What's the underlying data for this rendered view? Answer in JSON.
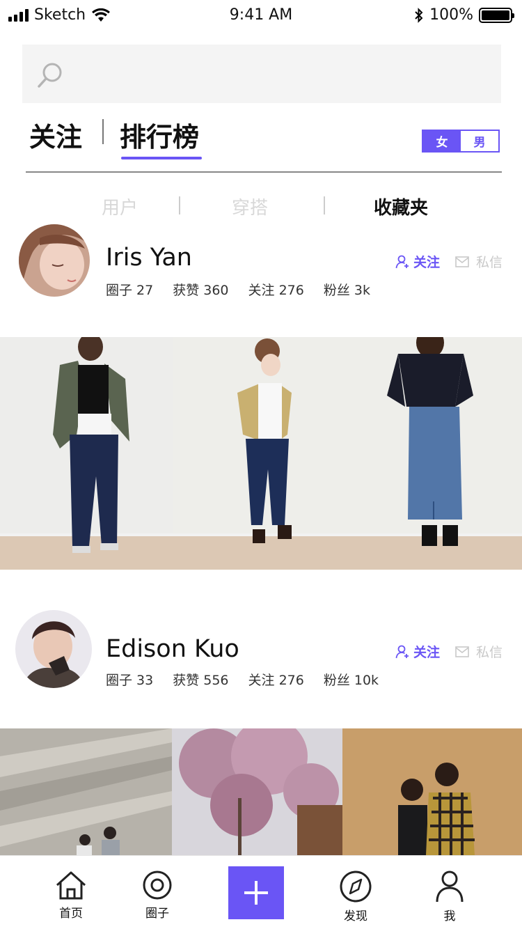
{
  "status_bar": {
    "carrier": "Sketch",
    "time": "9:41 AM",
    "battery": "100%"
  },
  "search": {
    "placeholder": ""
  },
  "top_tabs": {
    "following": "关注",
    "ranking": "排行榜",
    "active": "排行榜"
  },
  "gender_toggle": {
    "female": "女",
    "male": "男",
    "active": "女"
  },
  "sub_tabs": {
    "users": "用户",
    "outfits": "穿搭",
    "favorites": "收藏夹",
    "active": "收藏夹"
  },
  "users": [
    {
      "name": "Iris Yan",
      "stats": [
        "圈子 27",
        "获赞 360",
        "关注 276",
        "粉丝 3k"
      ],
      "follow_label": "关注",
      "message_label": "私信"
    },
    {
      "name": "Edison Kuo",
      "stats": [
        "圈子 33",
        "获赞 556",
        "关注 276",
        "粉丝 10k"
      ],
      "follow_label": "关注",
      "message_label": "私信"
    }
  ],
  "tab_bar": {
    "home": "首页",
    "circle": "圈子",
    "discover": "发现",
    "me": "我"
  },
  "colors": {
    "accent": "#6a55f5",
    "inactive_text": "#d8d8d8",
    "search_bg": "#f4f4f4"
  }
}
